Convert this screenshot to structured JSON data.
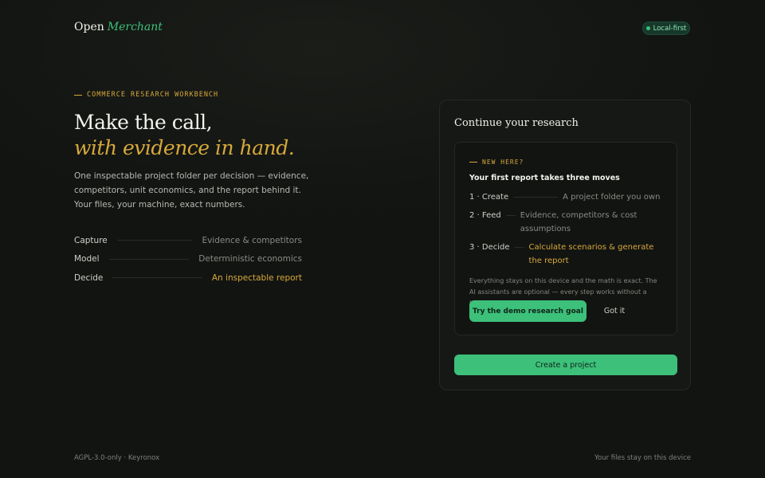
{
  "brand": {
    "open": "Open",
    "merchant": "Merchant"
  },
  "badge": {
    "label": "Local-first"
  },
  "hero": {
    "eyebrow": "COMMERCE RESEARCH WORKBENCH",
    "title_line1": "Make the call,",
    "title_line2": "with evidence in hand.",
    "lede": "One inspectable project folder per decision — evidence, competitors, unit economics, and the report behind it. Your files, your machine, exact numbers.",
    "steps": [
      {
        "key": "Capture",
        "value": "Evidence & competitors"
      },
      {
        "key": "Model",
        "value": "Deterministic economics"
      },
      {
        "key": "Decide",
        "value": "An inspectable report"
      }
    ]
  },
  "card": {
    "title": "Continue your research",
    "onboarding": {
      "eyebrow": "NEW HERE?",
      "subtitle": "Your first report takes three moves",
      "moves": [
        {
          "key": "1 · Create",
          "value": "A project folder you own"
        },
        {
          "key": "2 · Feed",
          "value": "Evidence, competitors & cost assumptions"
        },
        {
          "key": "3 · Decide",
          "value": "Calculate scenarios & generate the report"
        }
      ],
      "note": "Everything stays on this device and the math is exact. The AI assistants are optional — every step works without a key.",
      "demo_button": "Try the demo research goal",
      "dismiss_button": "Got it"
    },
    "create_button": "Create a project"
  },
  "footer": {
    "left": "AGPL-3.0-only · Keyronox",
    "right": "Your files stay on this device"
  },
  "colors": {
    "accent_green": "#3cc07a",
    "accent_gold": "#d6a93a",
    "background": "#121412"
  }
}
